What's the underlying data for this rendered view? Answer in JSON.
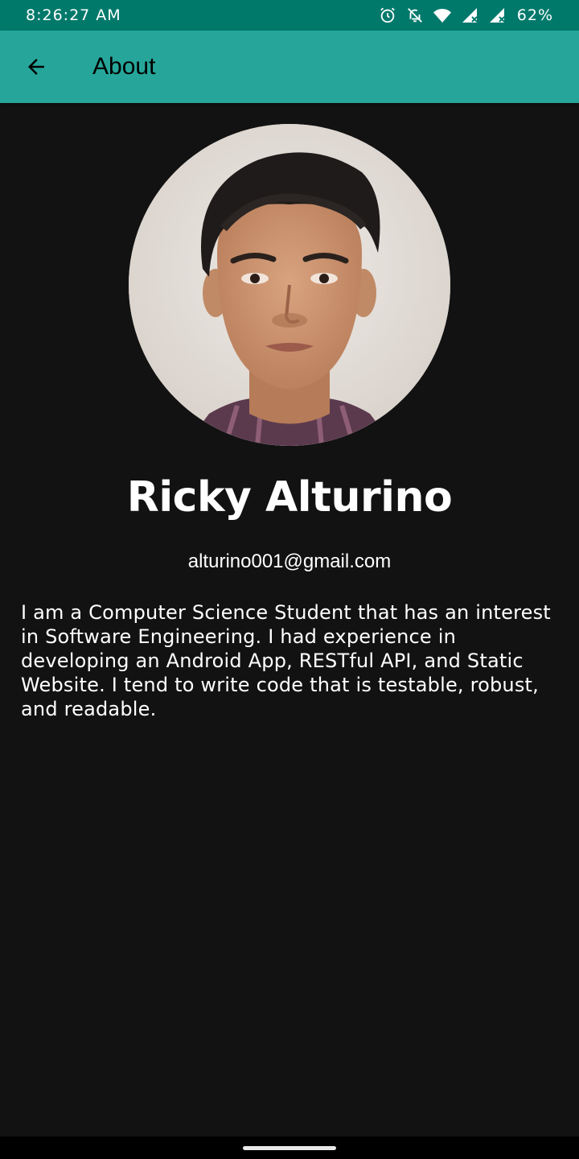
{
  "status_bar": {
    "time": "8:26:27 AM",
    "battery": "62%",
    "icons": [
      "alarm-icon",
      "mute-icon",
      "wifi-icon",
      "signal-icon",
      "signal-icon"
    ]
  },
  "app_bar": {
    "title": "About",
    "back_icon": "arrow-left-icon",
    "color": "#26a69a"
  },
  "profile": {
    "avatar": "profile-photo",
    "name": "Ricky Alturino",
    "email": "alturino001@gmail.com",
    "bio": "I am a Computer Science Student that has an interest in Software Engineering. I had experience in developing an Android App, RESTful API, and Static Website. I tend to write code that is testable, robust, and readable."
  },
  "colors": {
    "status_bar": "#00796b",
    "background": "#121212",
    "text": "#ffffff"
  }
}
